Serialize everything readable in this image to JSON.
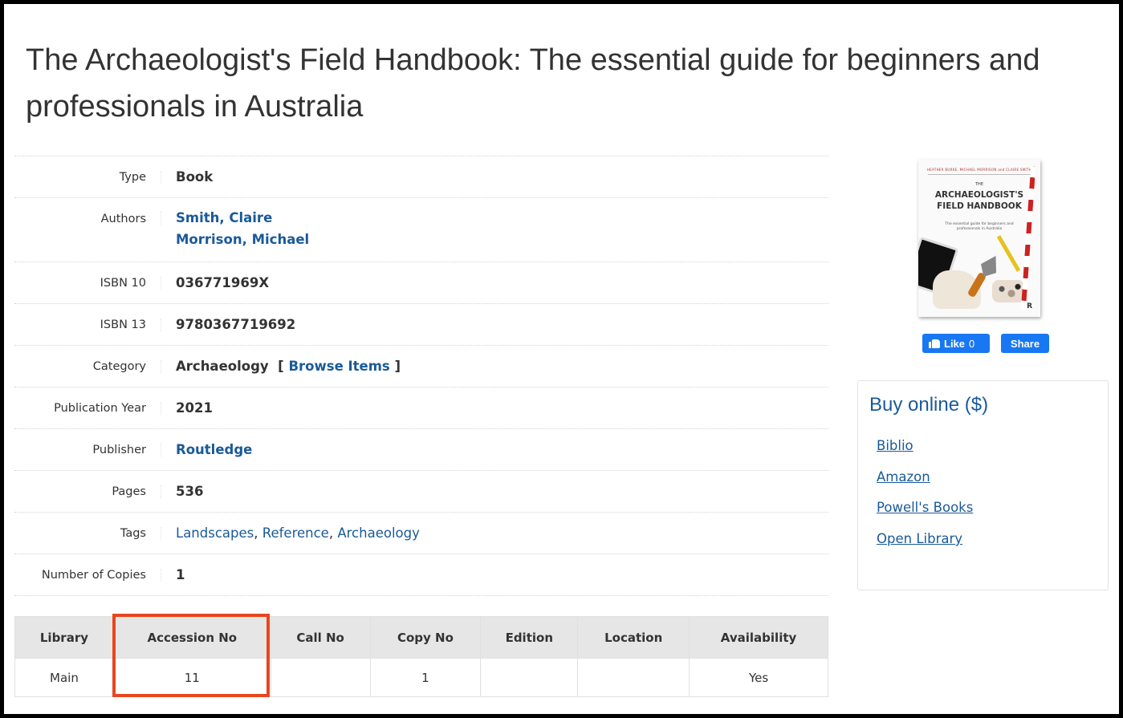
{
  "title": "The Archaeologist's Field Handbook: The essential guide for beginners and professionals in Australia",
  "details": {
    "type": {
      "label": "Type",
      "value": "Book"
    },
    "authors": {
      "label": "Authors",
      "items": [
        "Smith, Claire",
        "Morrison, Michael"
      ]
    },
    "isbn10": {
      "label": "ISBN 10",
      "value": "036771969X"
    },
    "isbn13": {
      "label": "ISBN 13",
      "value": "9780367719692"
    },
    "category": {
      "label": "Category",
      "value": "Archaeology",
      "browse_open": "[",
      "browse_label": "Browse Items",
      "browse_close": "]"
    },
    "publication_year": {
      "label": "Publication Year",
      "value": "2021"
    },
    "publisher": {
      "label": "Publisher",
      "value": "Routledge"
    },
    "pages": {
      "label": "Pages",
      "value": "536"
    },
    "tags": {
      "label": "Tags",
      "items": [
        "Landscapes",
        "Reference",
        "Archaeology"
      ]
    },
    "copies": {
      "label": "Number of Copies",
      "value": "1"
    }
  },
  "copies_table": {
    "headers": [
      "Library",
      "Accession No",
      "Call No",
      "Copy No",
      "Edition",
      "Location",
      "Availability"
    ],
    "rows": [
      [
        "Main",
        "11",
        "",
        "1",
        "",
        "",
        "Yes"
      ]
    ]
  },
  "cover": {
    "authors": "HEATHER BURKE, MICHAEL MORRISON and CLAIRE SMITH",
    "title_the": "THE",
    "title_line1": "ARCHAEOLOGIST'S",
    "title_line2": "FIELD HANDBOOK",
    "subtitle": "The essential guide for beginners and professionals in Australia",
    "publisher_mark": "R"
  },
  "social": {
    "like_label": "Like",
    "like_count": "0",
    "share_label": "Share"
  },
  "buy": {
    "title": "Buy online ($)",
    "links": [
      "Biblio",
      "Amazon",
      "Powell's Books",
      "Open Library"
    ]
  },
  "colors": {
    "link": "#1a5a9a",
    "highlight": "#e8461e",
    "facebook": "#1877f2",
    "table_header_bg": "#e6e6e6"
  }
}
